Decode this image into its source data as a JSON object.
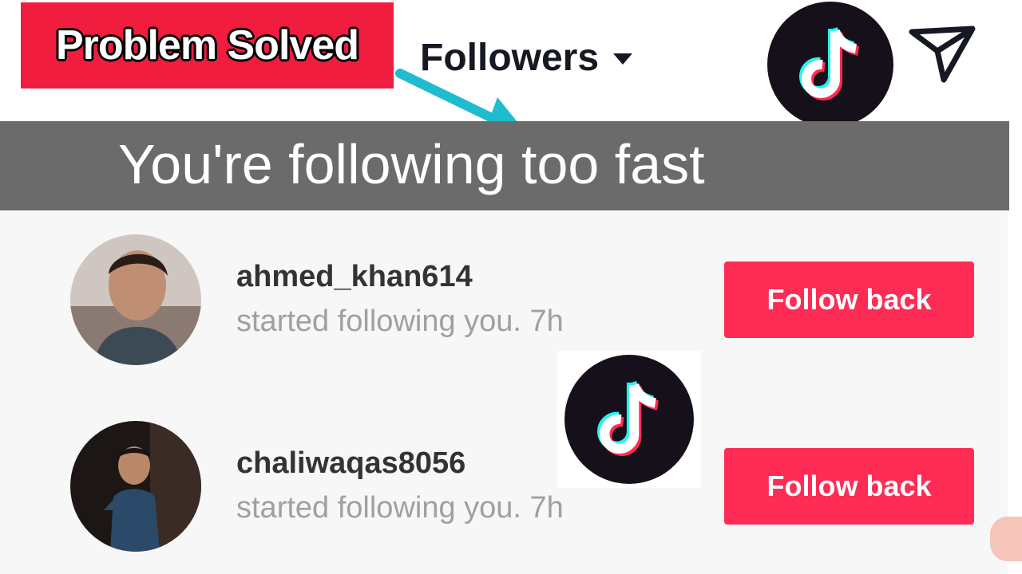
{
  "overlay": {
    "badge_text": "Problem Solved",
    "badge_color": "#f01d3f",
    "arrow_color": "#1fbcd0"
  },
  "header": {
    "title": "Followers",
    "dropdown_icon": "caret-down-icon",
    "send_icon": "paper-plane-icon",
    "logo_icon": "tiktok-logo-icon"
  },
  "toast": {
    "message": "You're following too fast",
    "background": "#6b6b6b"
  },
  "followers": [
    {
      "username": "ahmed_khan614",
      "activity": "started following you. 7h",
      "button_label": "Follow back",
      "avatar_icon": "avatar-photo"
    },
    {
      "username": "chaliwaqas8056",
      "activity": "started following you. 7h",
      "button_label": "Follow back",
      "avatar_icon": "avatar-photo"
    }
  ],
  "colors": {
    "accent": "#fe2c55",
    "text_primary": "#333333",
    "text_secondary": "#a0a0a0"
  }
}
